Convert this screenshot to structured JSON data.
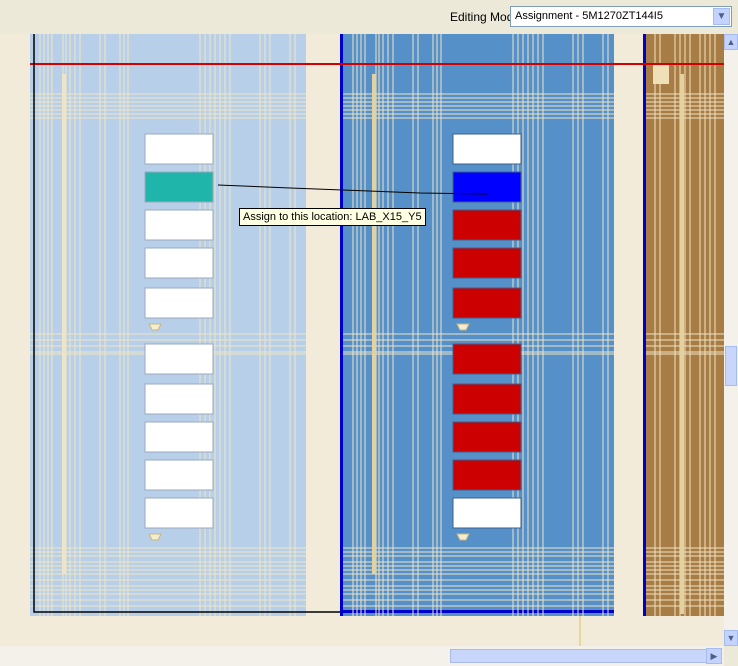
{
  "toolbar": {
    "editing_mode_label": "Editing Mode:",
    "editing_mode_value": "Assignment - 5M1270ZT144I5"
  },
  "tooltip": {
    "text": "Assign to this location: LAB_X15_Y5"
  },
  "floorplan": {
    "colors": {
      "left_region": "#b8cfe9",
      "center_region": "#5690c8",
      "right_region": "#a87d45",
      "background": "#f2ebda",
      "routing_lines": "#efe4c4",
      "empty_cell": "#ffffff",
      "source_cell": "#1fb5aa",
      "target_cell": "#0000ff",
      "occupied_cell": "#cc0000",
      "boundary_line": "#d20000"
    },
    "left_column_cells": [
      "empty",
      "source",
      "empty",
      "empty",
      "empty",
      "empty",
      "empty",
      "empty",
      "empty",
      "empty"
    ],
    "center_column_cells": [
      "empty",
      "target",
      "occupied",
      "occupied",
      "occupied",
      "occupied",
      "occupied",
      "occupied",
      "occupied",
      "empty"
    ]
  }
}
